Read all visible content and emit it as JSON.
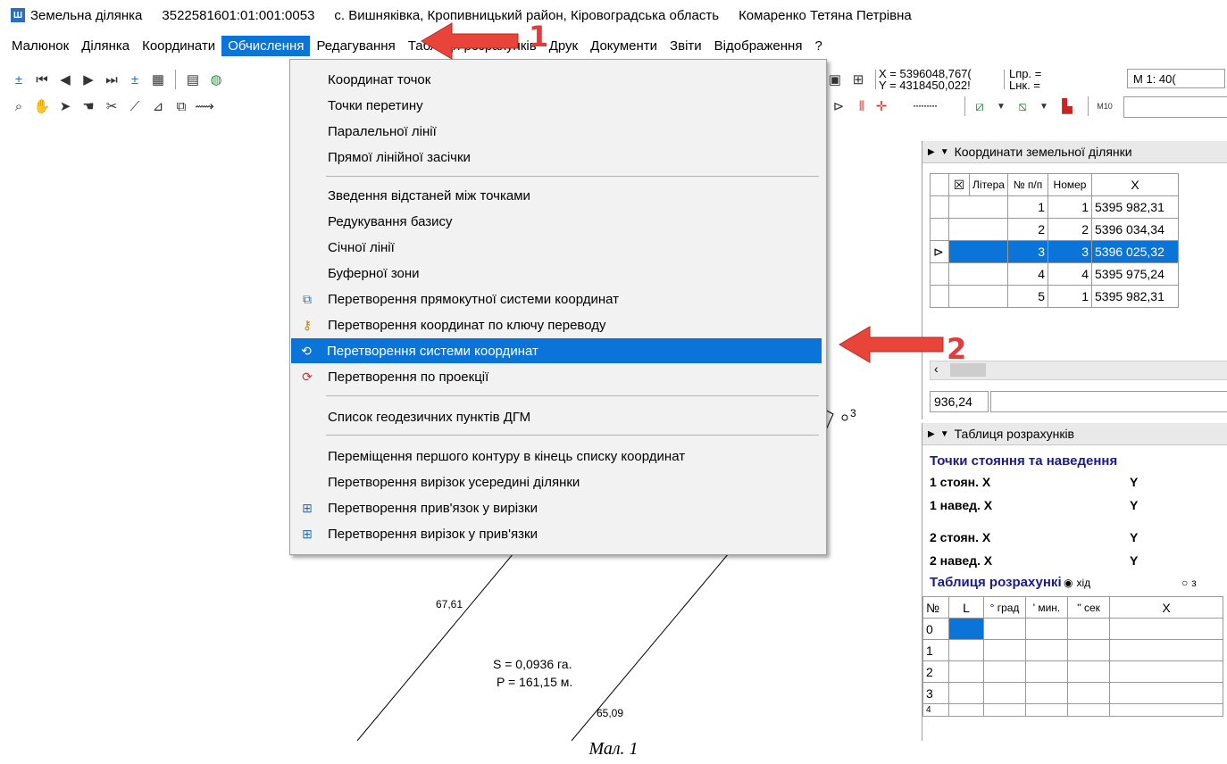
{
  "title": {
    "app_name": "Земельна ділянка",
    "cadastral": "3522581601:01:001:0053",
    "location": "с. Вишняківка, Кропивницький район, Кіровоградська область",
    "owner": "Комаренко Тетяна Петрівна"
  },
  "menu": [
    "Малюнок",
    "Ділянка",
    "Координати",
    "Обчислення",
    "Редагування",
    "Таблиця розрахунків",
    "Друк",
    "Документи",
    "Звіти",
    "Відображення",
    "?"
  ],
  "toolbar": {
    "x_readout": "X = 5396048,767(",
    "y_readout": "Y = 4318450,022!",
    "lpr": "Lпр. =",
    "lnk": "Lнк. =",
    "scale": "M 1: 40("
  },
  "dropdown": {
    "items": [
      "Координат точок",
      "Точки перетину",
      "Паралельної лінії",
      "Прямої лінійної засічки",
      "Зведення відстаней між точками",
      "Редукування базису",
      "Січної лінії",
      "Буферної зони",
      "Перетворення прямокутної системи координат",
      "Перетворення координат по ключу переводу",
      "Перетворення системи координат",
      "Перетворення по проекції",
      "Список геодезичних пунктів ДГМ",
      "Переміщення першого контуру в кінець списку координат",
      "Перетворення вирізок усередині ділянки",
      "Перетворення прив'язок у вирізки",
      "Перетворення вирізок у прив'язки"
    ],
    "highlighted_index": 10
  },
  "coords_panel": {
    "title": "Координати земельної ділянки",
    "columns": [
      "Літера",
      "№ п/п",
      "Номер",
      "X"
    ],
    "rows": [
      {
        "n": "1",
        "num": "1",
        "x": "5395 982,31"
      },
      {
        "n": "2",
        "num": "2",
        "x": "5396 034,34"
      },
      {
        "n": "3",
        "num": "3",
        "x": "5396 025,32"
      },
      {
        "n": "4",
        "num": "4",
        "x": "5395 975,24"
      },
      {
        "n": "5",
        "num": "1",
        "x": "5395 982,31"
      }
    ],
    "selected_row": 2,
    "footer_value": "936,24"
  },
  "calc_panel": {
    "title": "Таблиця розрахунків",
    "subtitle": "Точки стояння та наведення",
    "rows": [
      {
        "label": "1 стоян. X",
        "y": "Y"
      },
      {
        "label": "1 навед. X",
        "y": "Y"
      },
      {
        "label": "2 стоян. X",
        "y": "Y"
      },
      {
        "label": "2 навед. X",
        "y": "Y"
      }
    ],
    "table_label": "Таблиця розрахункі",
    "radio1": "хід",
    "radio2": "з",
    "columns": [
      "№",
      "L",
      "° град",
      "' мин.",
      "'' сек",
      "X"
    ],
    "row_numbers": [
      "0",
      "1",
      "2",
      "3",
      "4"
    ]
  },
  "drawing": {
    "point_label": "3",
    "len1": "67,61",
    "len2": "65,09",
    "area": "S = 0,0936 га.",
    "perimeter": "P = 161,15 м."
  },
  "annotations": {
    "marker1": "1",
    "marker2": "2"
  },
  "caption": "Мал. 1"
}
